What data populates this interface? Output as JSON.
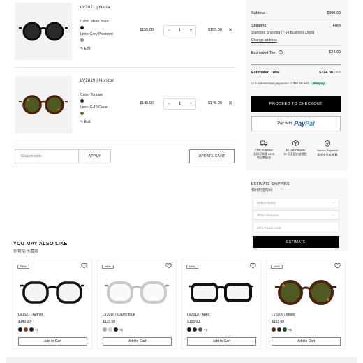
{
  "cart": {
    "items": [
      {
        "name": "LV3021 | Neria",
        "color_label": "Color: Matte Black",
        "color_hex": "#111111",
        "lens_label": "Lens:  Grey Polarized",
        "lens_hex": "#8a8a8a",
        "edit": "Edit",
        "price": "$155.00",
        "qty": "1",
        "line_total": "$155.00",
        "remove_icon": "close-icon",
        "frame": "matte-black",
        "lens": "grey"
      },
      {
        "name": "LV2019 | Horizon",
        "color_label": "Color: Tortoise",
        "color_hex": "#3a1d10",
        "lens_label": "Lens:  G-15 Green",
        "lens_hex": "#5d6b2e",
        "edit": "Edit",
        "price": "$145.00",
        "qty": "1",
        "line_total": "$145.00",
        "remove_icon": "close-icon",
        "frame": "tortoise",
        "lens": "green"
      }
    ],
    "qty_minus": "−",
    "qty_plus": "+",
    "coupon_placeholder": "Coupon code",
    "apply_label": "APPLY",
    "update_label": "UPDATE CART"
  },
  "summary": {
    "subtotal_label": "Subtotal",
    "subtotal_value": "$300.00",
    "shipping_label": "Shipping",
    "shipping_value": "Free",
    "shipping_method": "Standard Shipping (7-14 Business Days)",
    "change_address": "Change address",
    "tax_label": "Estimated Tax",
    "tax_value": "$24.00",
    "total_label": "Estimated Total",
    "total_value": "$324.00",
    "currency": "USD",
    "installments_text": "or 4 interest-free payments of $81.00 with",
    "afterpay_label": "afterpay",
    "checkout_label": "PROCEED TO CHECKOUT",
    "paypal_prefix": "Pay with",
    "paypal_brand_1": "Pay",
    "paypal_brand_2": "Pal",
    "benefits": [
      {
        "icon": "truck-icon",
        "line1": "Free Shipping",
        "line2": "全球订单满 $120",
        "line3": "免运费配送"
      },
      {
        "icon": "box-icon",
        "line1": "30-Day Returns",
        "line2": "30 天无理由退换货",
        "line3": ""
      },
      {
        "icon": "shield-icon",
        "line1": "Secure Payment",
        "line2": "安全支付 & 结算",
        "line3": ""
      }
    ]
  },
  "estimate": {
    "title": "ESTIMATE SHIPPING",
    "subtitle": "预计配送时间",
    "country": "United States",
    "state_placeholder": "State / Province",
    "zip_placeholder": "ZIP / Postal Code",
    "button": "ESTIMATE"
  },
  "recommend": {
    "title": "YOU MAY ALSO LIKE",
    "subtitle": "你可能也喜欢",
    "badge": "NEW",
    "add_label": "Add to Cart",
    "products": [
      {
        "name": "LV1021 | Aether",
        "price": "$145.00",
        "swatches": [
          "#111111",
          "#7a3e1c",
          "#222222"
        ],
        "more": "+2",
        "frame": "black-clear"
      },
      {
        "name": "LV2010 | Clarity Blue",
        "price": "$135.00",
        "swatches": [
          "#a9a9a9",
          "#cfcfcf",
          "#222222"
        ],
        "more": "+2",
        "frame": "clear"
      },
      {
        "name": "LV3018 | Apex",
        "price": "$155.00",
        "swatches": [
          "#111111",
          "#222222",
          "#555555"
        ],
        "more": "+1",
        "frame": "black-clear"
      },
      {
        "name": "LV2006 | Muse",
        "price": "$155.00",
        "swatches": [
          "#5a2e14",
          "#2b2b2b",
          "#2d4a2a"
        ],
        "more": "+2",
        "frame": "tortoise-green"
      }
    ]
  }
}
